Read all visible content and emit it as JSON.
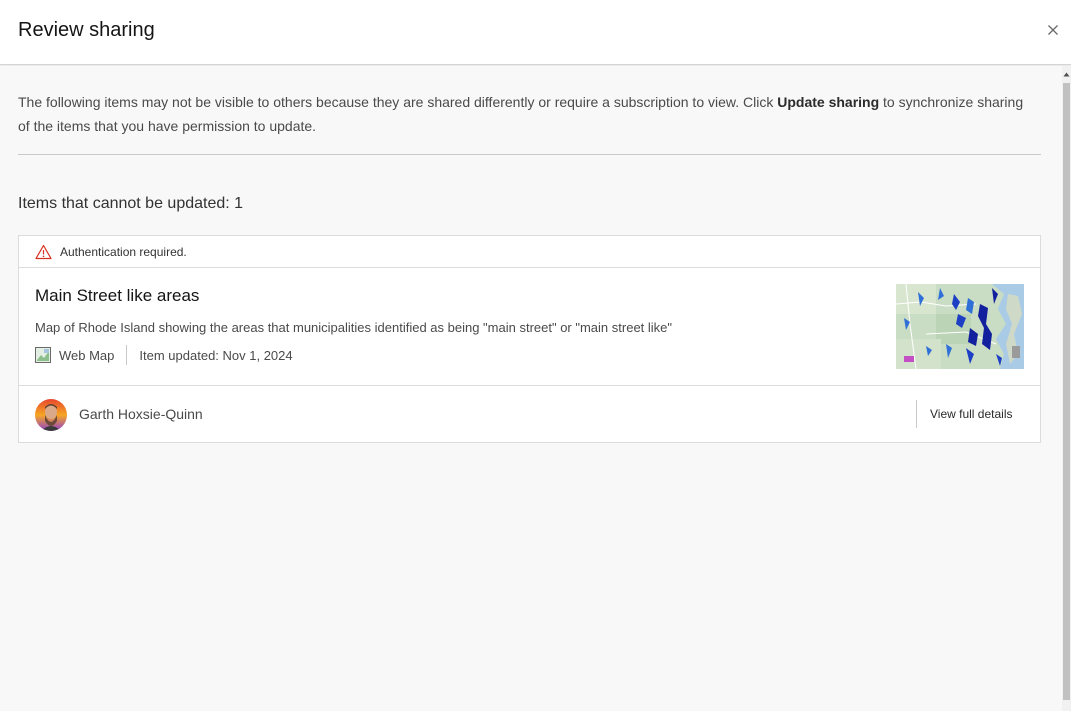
{
  "dialog": {
    "title": "Review sharing",
    "close_icon": "close-icon"
  },
  "intro": {
    "text_before": "The following items may not be visible to others because they are shared differently or require a subscription to view. Click ",
    "bold": "Update sharing",
    "text_after": " to synchronize sharing of the items that you have permission to update."
  },
  "section": {
    "heading": "Items that cannot be updated: 1"
  },
  "item": {
    "alert_icon": "warning-triangle-icon",
    "alert_text": "Authentication required.",
    "title": "Main Street like areas",
    "description": "Map of Rhode Island showing the areas that municipalities identified as being \"main street\" or \"main street like\"",
    "type_icon": "web-map-icon",
    "type": "Web Map",
    "updated": "Item updated: Nov 1, 2024",
    "thumbnail": "map-thumbnail",
    "owner": "Garth Hoxsie-Quinn",
    "details_link": "View full details"
  },
  "colors": {
    "warning": "#d83020",
    "background": "#f8f8f8",
    "card": "#ffffff"
  }
}
